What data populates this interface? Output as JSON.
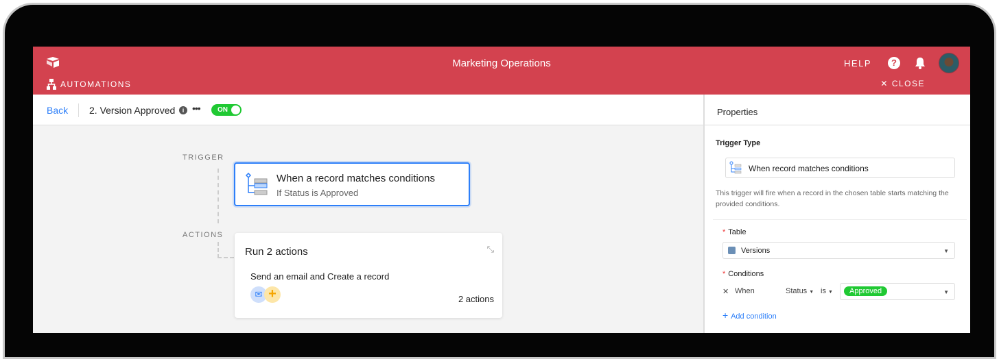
{
  "header": {
    "title": "Marketing Operations",
    "section": "AUTOMATIONS",
    "help": "HELP",
    "close": "CLOSE",
    "brand_color": "#d3424f"
  },
  "toolbar": {
    "back": "Back",
    "workflow_name": "2. Version Approved",
    "toggle": "ON"
  },
  "canvas": {
    "trigger_label": "TRIGGER",
    "actions_label": "ACTIONS",
    "trigger_card": {
      "title": "When a record matches conditions",
      "subtitle": "If Status is Approved"
    },
    "actions_card": {
      "title": "Run 2 actions",
      "description": "Send an email and Create a record",
      "count": "2 actions"
    }
  },
  "properties": {
    "title": "Properties",
    "trigger_type_label": "Trigger Type",
    "trigger_type": "When record matches conditions",
    "description": "This trigger will fire when a record in the chosen table starts matching the provided conditions.",
    "table_label": "Table",
    "table_value": "Versions",
    "conditions_label": "Conditions",
    "condition": {
      "when": "When",
      "field": "Status",
      "operator": "is",
      "value": "Approved"
    },
    "add_condition": "Add condition"
  }
}
